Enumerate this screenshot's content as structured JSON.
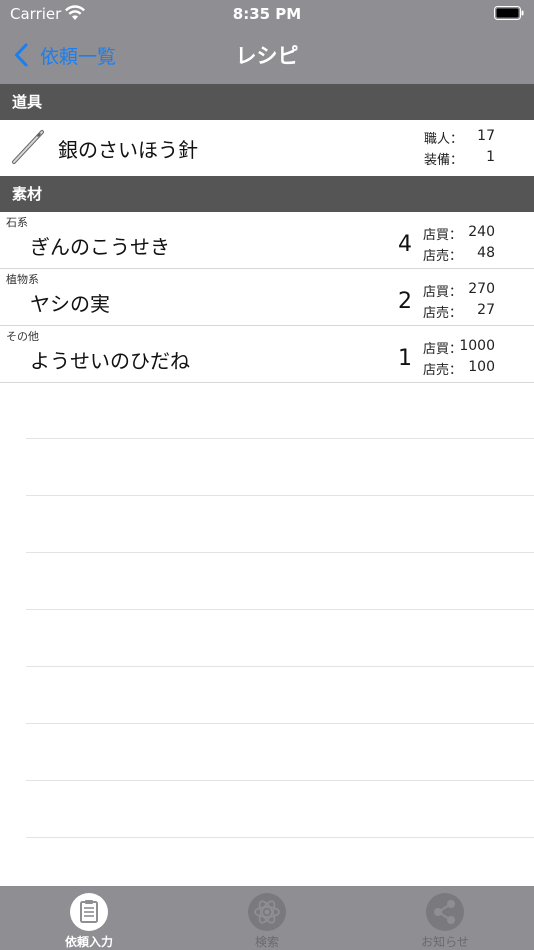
{
  "status_bar": {
    "carrier": "Carrier",
    "time": "8:35 PM"
  },
  "nav": {
    "back_label": "依頼一覧",
    "title": "レシピ"
  },
  "sections": {
    "tools": "道具",
    "materials": "素材"
  },
  "tool": {
    "name": "銀のさいほう針",
    "icon": "needle-icon",
    "stats": [
      {
        "label": "職人：",
        "value": "17"
      },
      {
        "label": "装備：",
        "value": "1"
      }
    ]
  },
  "materials": [
    {
      "category": "石系",
      "name": "ぎんのこうせき",
      "quantity": "4",
      "buy_label": "店買：",
      "buy": "240",
      "sell_label": "店売：",
      "sell": "48"
    },
    {
      "category": "植物系",
      "name": "ヤシの実",
      "quantity": "2",
      "buy_label": "店買：",
      "buy": "270",
      "sell_label": "店売：",
      "sell": "27"
    },
    {
      "category": "その他",
      "name": "ようせいのひだね",
      "quantity": "1",
      "buy_label": "店買：",
      "buy": "1000",
      "sell_label": "店売：",
      "sell": "100"
    }
  ],
  "tabs": [
    {
      "label": "依頼入力",
      "icon": "clipboard-icon",
      "active": true
    },
    {
      "label": "検索",
      "icon": "atom-icon",
      "active": false
    },
    {
      "label": "お知らせ",
      "icon": "share-icon",
      "active": false
    }
  ],
  "colors": {
    "nav_gray": "#8e8e93",
    "section_gray": "#555555",
    "accent_blue": "#1a7ff0"
  }
}
